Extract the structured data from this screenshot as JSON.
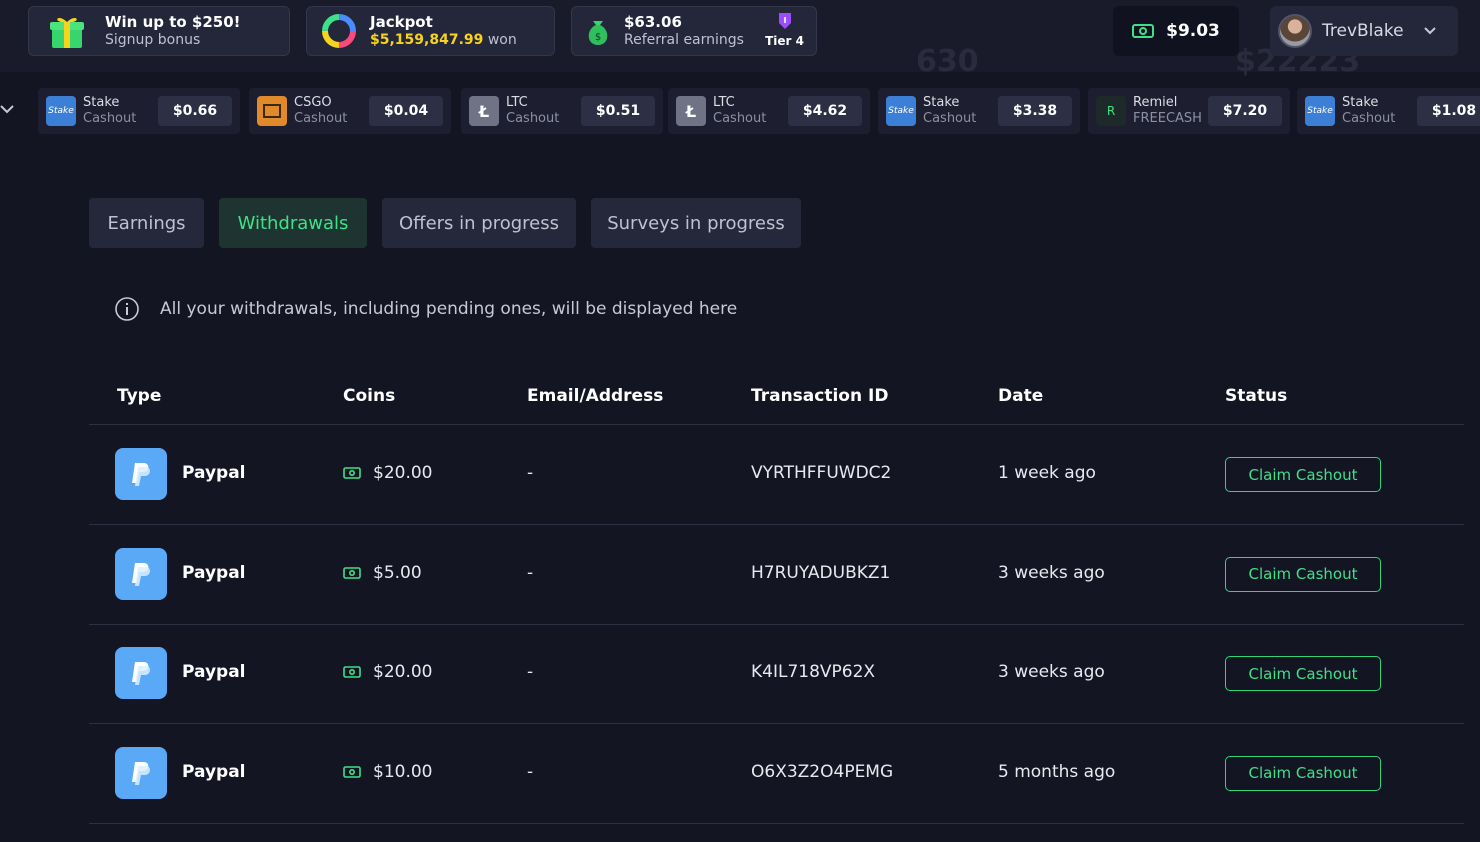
{
  "header": {
    "signup": {
      "title": "Win up to $250!",
      "subtitle": "Signup bonus"
    },
    "jackpot": {
      "title": "Jackpot",
      "amount": "$5,159,847.99",
      "suffix": "won"
    },
    "referral": {
      "title": "$63.06",
      "subtitle": "Referral earnings",
      "tier": "Tier 4"
    },
    "balance": "$9.03",
    "username": "TrevBlake",
    "ghost_text": [
      "630",
      "$22223"
    ]
  },
  "ticker": [
    {
      "name": "Stake",
      "kind": "Cashout",
      "amount": "$0.66",
      "logo": "stake-logo",
      "color": "#3c7fd6"
    },
    {
      "name": "CSGO",
      "kind": "Cashout",
      "amount": "$0.04",
      "logo": "csgo-logo",
      "color": "#e08a2b"
    },
    {
      "name": "LTC",
      "kind": "Cashout",
      "amount": "$0.51",
      "logo": "ltc-logo",
      "color": "#6f7385"
    },
    {
      "name": "LTC",
      "kind": "Cashout",
      "amount": "$4.62",
      "logo": "ltc-logo",
      "color": "#6f7385"
    },
    {
      "name": "Stake",
      "kind": "Cashout",
      "amount": "$3.38",
      "logo": "stake-logo",
      "color": "#3c7fd6"
    },
    {
      "name": "Remiel",
      "kind": "FREECASH",
      "amount": "$7.20",
      "logo": "freecash-logo",
      "color": "#1e2a2a"
    },
    {
      "name": "Stake",
      "kind": "Cashout",
      "amount": "$1.08",
      "logo": "stake-logo",
      "color": "#3c7fd6"
    }
  ],
  "tabs": [
    {
      "label": "Earnings",
      "active": false
    },
    {
      "label": "Withdrawals",
      "active": true
    },
    {
      "label": "Offers in progress",
      "active": false
    },
    {
      "label": "Surveys in progress",
      "active": false
    }
  ],
  "info_text": "All your withdrawals, including pending ones, will be displayed here",
  "table": {
    "headers": [
      "Type",
      "Coins",
      "Email/Address",
      "Transaction ID",
      "Date",
      "Status"
    ],
    "rows": [
      {
        "type": "Paypal",
        "coins": "$20.00",
        "address": "-",
        "txid": "VYRTHFFUWDC2",
        "date": "1 week ago",
        "status": "Claim Cashout"
      },
      {
        "type": "Paypal",
        "coins": "$5.00",
        "address": "-",
        "txid": "H7RUYADUBKZ1",
        "date": "3 weeks ago",
        "status": "Claim Cashout"
      },
      {
        "type": "Paypal",
        "coins": "$20.00",
        "address": "-",
        "txid": "K4IL718VP62X",
        "date": "3 weeks ago",
        "status": "Claim Cashout"
      },
      {
        "type": "Paypal",
        "coins": "$10.00",
        "address": "-",
        "txid": "O6X3Z2O4PEMG",
        "date": "5 months ago",
        "status": "Claim Cashout"
      }
    ]
  },
  "colors": {
    "accent": "#3fe089",
    "background": "#141523",
    "panel": "#24263a",
    "paypal": "#5aa9f7",
    "jackpot": "#f6d31f"
  }
}
